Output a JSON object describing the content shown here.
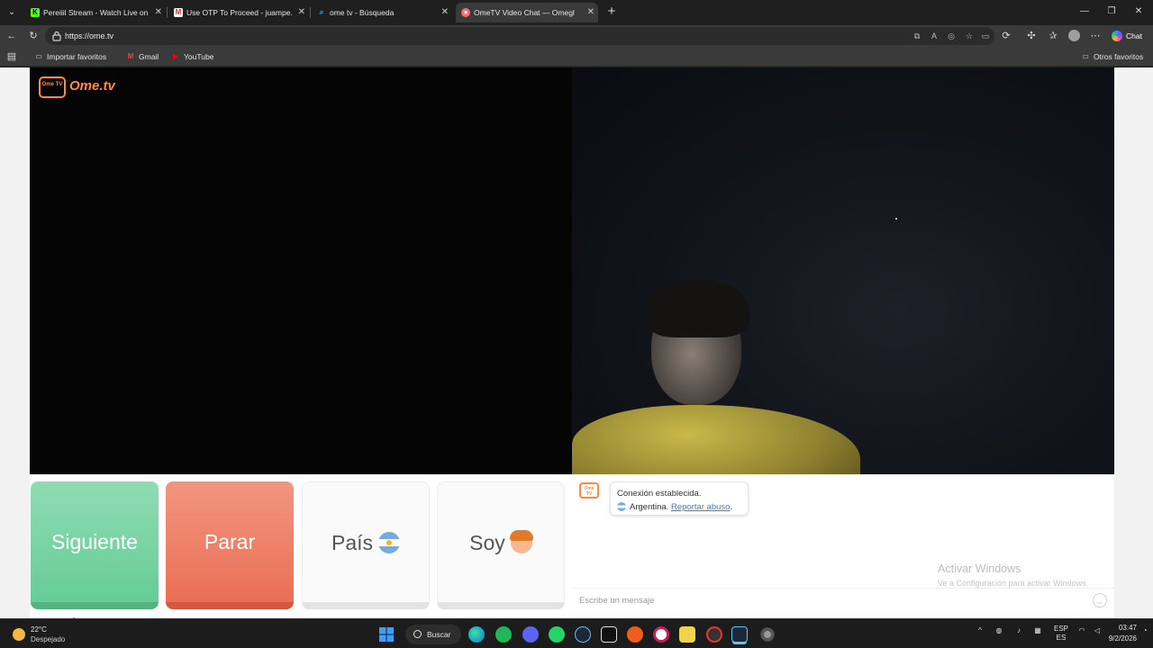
{
  "browser": {
    "tabs": [
      {
        "title": "Pereiiil Stream - Watch Live on Kic",
        "favicon": "kick-icon",
        "active": false
      },
      {
        "title": "Use OTP To Proceed - juampe.cba",
        "favicon": "gmail-icon",
        "active": false
      },
      {
        "title": "ome tv - Búsqueda",
        "favicon": "search-icon",
        "active": false
      },
      {
        "title": "OmeTV Video Chat — Omegl",
        "favicon": "ometv-icon",
        "active": true
      }
    ],
    "url": "https://ome.tv",
    "chat_button": "Chat",
    "bookmarks": [
      {
        "label": "Importar favoritos"
      },
      {
        "label": "Gmail"
      },
      {
        "label": "YouTube"
      }
    ],
    "other_favorites": "Otros favoritos"
  },
  "site": {
    "logo_text": "Ome.tv",
    "logo_badge": "Ome TV"
  },
  "controls": {
    "next": "Siguiente",
    "stop": "Parar",
    "country": "País",
    "me": "Soy"
  },
  "chat": {
    "status": "Conexión establecida.",
    "country": "Argentina.",
    "report": "Reportar abuso",
    "report_suffix": ".",
    "placeholder": "Escribe un mensaje"
  },
  "watermark": {
    "title": "Activar Windows",
    "subtitle": "Ve a Configuración para activar Windows."
  },
  "taskbar": {
    "temperature": "22°C",
    "condition": "Despejado",
    "search": "Buscar",
    "lang_top": "ESP",
    "lang_bottom": "ES",
    "time": "03:47",
    "date": "9/2/2026"
  },
  "colors": {
    "next": "#67cc97",
    "stop": "#ea6f55",
    "brand": "#ff8a3d",
    "link": "#3b7fc4"
  }
}
